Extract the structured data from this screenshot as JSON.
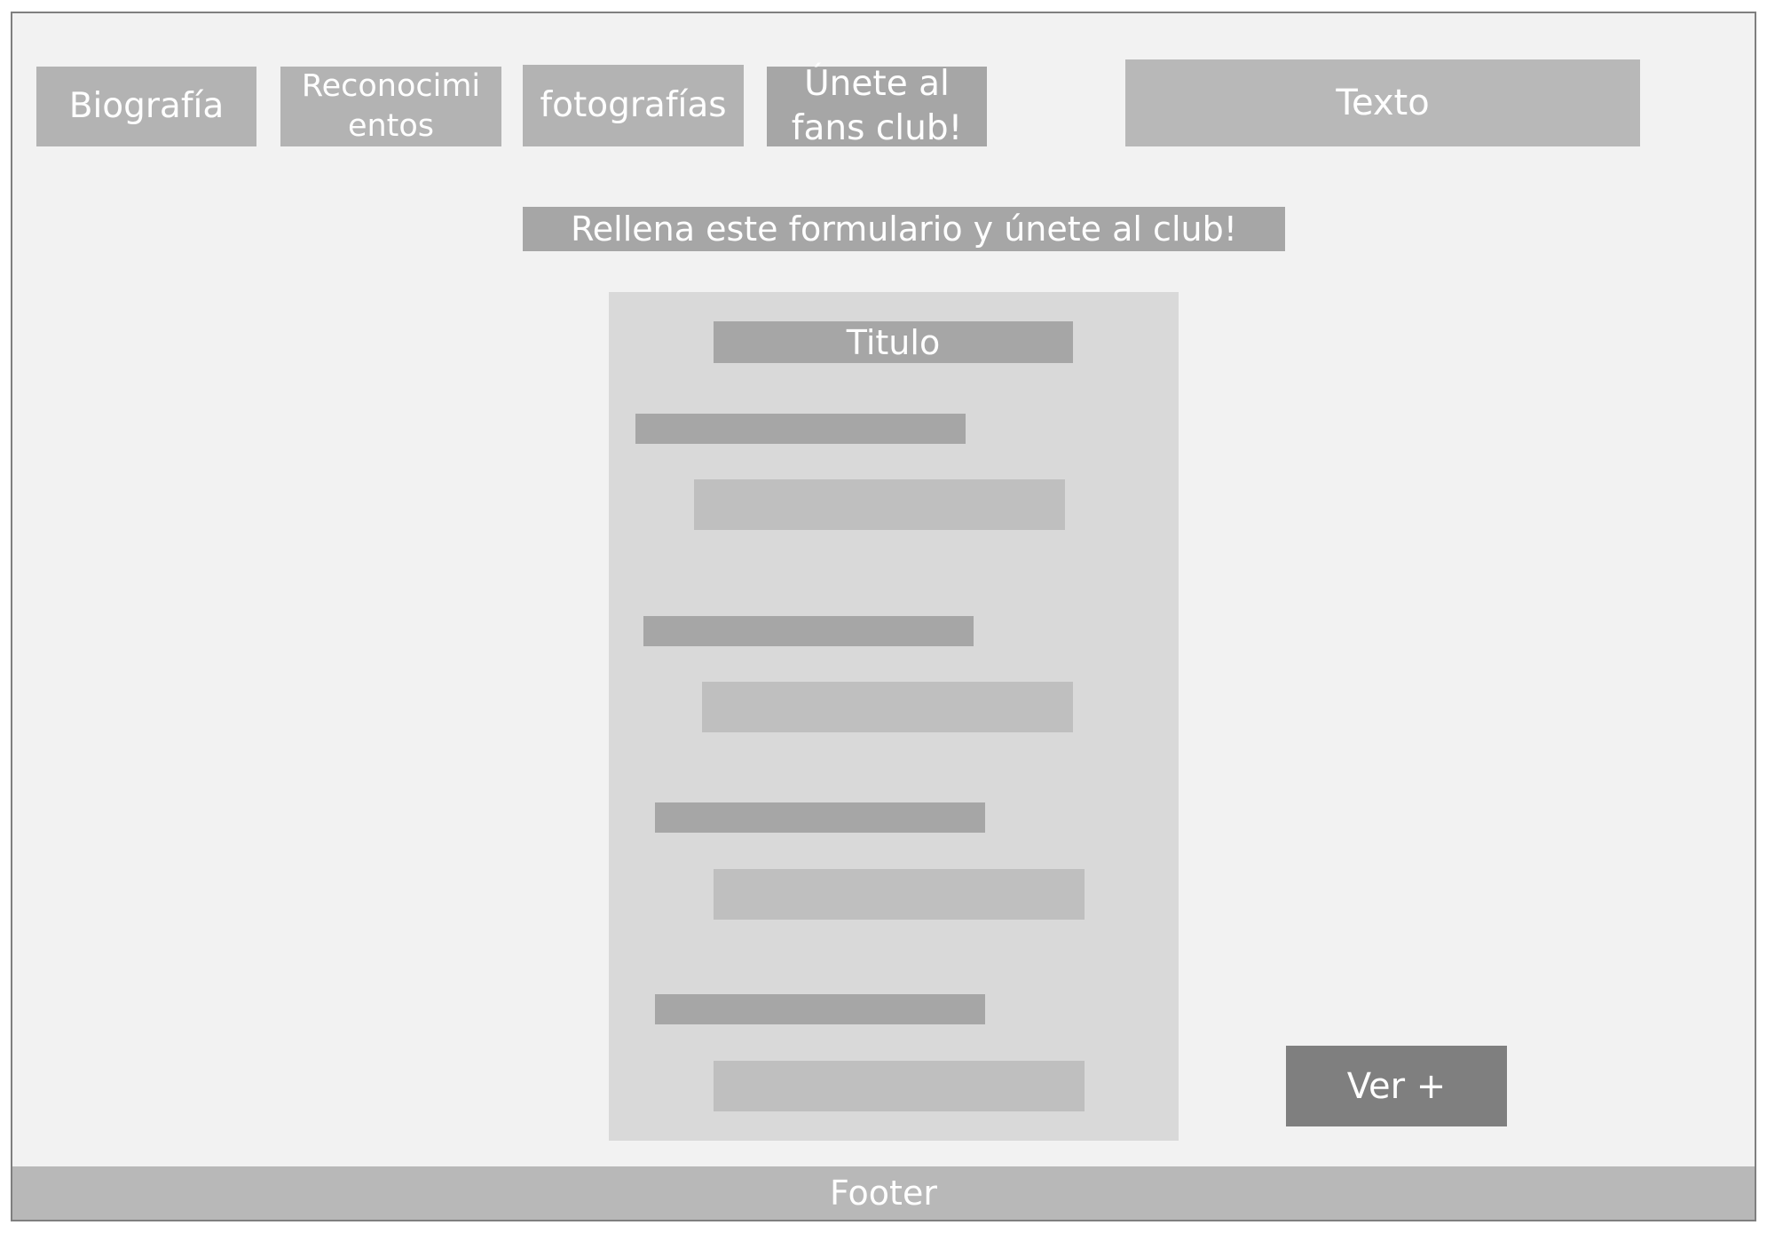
{
  "nav": {
    "biografia": "Biografía",
    "reconocimientos_line1": "Reconocimi",
    "reconocimientos_line2": "entos",
    "fotografias": "fotografías",
    "unete_line1": "Únete al",
    "unete_line2": "fans club!"
  },
  "header": {
    "texto": "Texto"
  },
  "banner": {
    "text": "Rellena este formulario y únete al club!"
  },
  "form": {
    "title": "Titulo",
    "fields": [
      {
        "label": "",
        "input": ""
      },
      {
        "label": "",
        "input": ""
      },
      {
        "label": "",
        "input": ""
      },
      {
        "label": "",
        "input": ""
      }
    ]
  },
  "actions": {
    "ver_mas": "Ver +"
  },
  "footer": {
    "text": "Footer"
  },
  "colors": {
    "page_background": "#f2f2f2",
    "nav_button": "#b3b3b3",
    "active_nav_button": "#a6a6a6",
    "form_panel": "#d9d9d9",
    "label_bar": "#a6a6a6",
    "input_bar": "#bfbfbf",
    "primary_button": "#7f7f7f",
    "text": "#ffffff"
  }
}
